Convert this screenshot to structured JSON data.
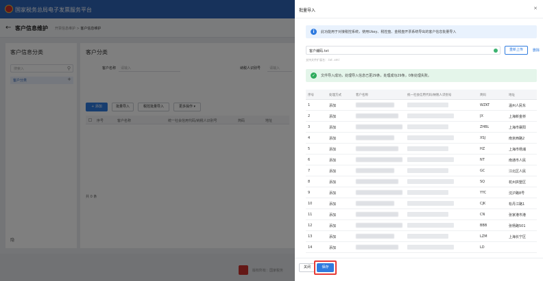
{
  "app": {
    "title": "国家税务总局电子发票服务平台"
  },
  "page": {
    "title": "客户信息维护",
    "breadcrumb_parent": "开票信息维护",
    "breadcrumb_current": "客户信息维护"
  },
  "left": {
    "title": "客户信息分类",
    "search_placeholder": "搜索入",
    "node_label": "客户分类",
    "footer_text": "隐"
  },
  "main": {
    "title": "客户分类",
    "field_name_label": "客户名称",
    "field_name_placeholder": "请输入",
    "field_tax_label": "纳税人识别号",
    "field_tax_placeholder": "请输入",
    "buttons": {
      "add": "+ 添加",
      "batch_import": "批量导入",
      "tax_import": "税控批量导入",
      "more": "更多操作 ▾"
    },
    "columns": [
      "序号",
      "客户名称",
      "统一社会信用代码/纳税人识别号",
      "简码",
      "地址"
    ],
    "total": "共 0 条"
  },
  "footer_bg": {
    "text": "版权所有：国家税务"
  },
  "modal": {
    "title": "批量导入",
    "close_glyph": "×",
    "info_text": "此功能用于对接税控系统，使用Ukey、税控盘、金税盘开票系统导出的客户信息批量导入",
    "file_name": "客户编码.txt",
    "reupload_label": "重新上传",
    "delete_label": "删除",
    "hint": "支持文件扩展名：.txt .xml",
    "success_text": "文件导入成功，处理导入信息已更29条，处理成功29条，0条处理失败。",
    "columns": [
      "序号",
      "处理方式",
      "客户名称",
      "统一社会信用代码/纳税人识别号",
      "简码",
      "地址"
    ],
    "rows": [
      {
        "no": "1",
        "action": "添加",
        "code": "WZKT",
        "addr": "温州人民东"
      },
      {
        "no": "2",
        "action": "添加",
        "code": "JX",
        "addr": "上海新金桥"
      },
      {
        "no": "3",
        "action": "添加",
        "code": "ZHBL",
        "addr": "上海市襄阳"
      },
      {
        "no": "4",
        "action": "添加",
        "code": "XSJ",
        "addr": "南京西路2"
      },
      {
        "no": "5",
        "action": "添加",
        "code": "HZ",
        "addr": "上海市杨浦"
      },
      {
        "no": "6",
        "action": "添加",
        "code": "NT",
        "addr": "南通市人民"
      },
      {
        "no": "7",
        "action": "添加",
        "code": "GC",
        "addr": "江北区人民"
      },
      {
        "no": "8",
        "action": "添加",
        "code": "SQ",
        "addr": "杭州拱墅区"
      },
      {
        "no": "9",
        "action": "添加",
        "code": "YYC",
        "addr": "沈沪路8号"
      },
      {
        "no": "10",
        "action": "添加",
        "code": "CJK",
        "addr": "松丹江路1"
      },
      {
        "no": "11",
        "action": "添加",
        "code": "CN",
        "addr": "张家港市港"
      },
      {
        "no": "12",
        "action": "添加",
        "code": "BBB",
        "addr": "张杨路501"
      },
      {
        "no": "13",
        "action": "添加",
        "code": "LZM",
        "addr": "上海长宁区"
      },
      {
        "no": "14",
        "action": "添加",
        "code": "LD",
        "addr": ""
      }
    ],
    "close_button": "关闭",
    "save_button": "保存"
  }
}
